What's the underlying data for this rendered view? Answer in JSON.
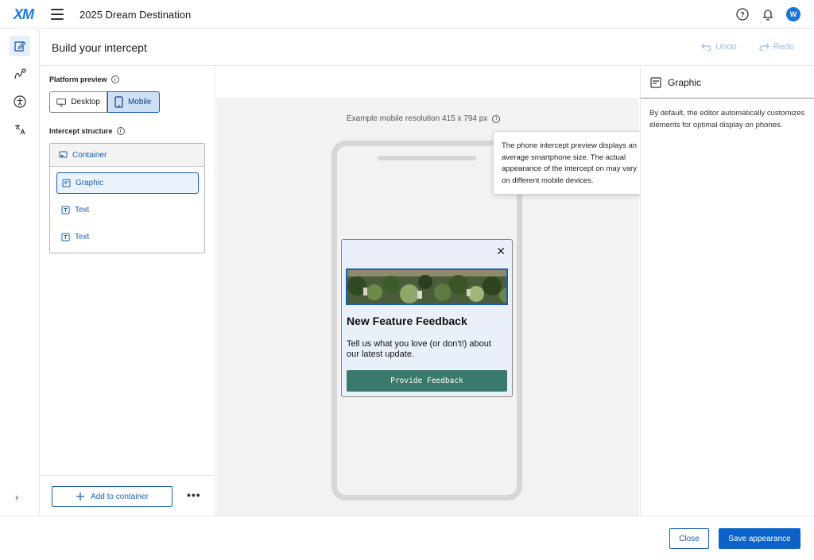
{
  "topbar": {
    "logo": "XM",
    "project_title": "2025 Dream Destination",
    "avatar_initial": "W"
  },
  "header": {
    "title": "Build your intercept",
    "undo_label": "Undo",
    "redo_label": "Redo"
  },
  "left_panel": {
    "platform_preview_label": "Platform preview",
    "desktop_label": "Desktop",
    "mobile_label": "Mobile",
    "selected_platform": "Mobile",
    "intercept_structure_label": "Intercept structure",
    "container_label": "Container",
    "items": [
      {
        "label": "Graphic",
        "icon": "graphic-icon",
        "selected": true
      },
      {
        "label": "Text",
        "icon": "text-icon",
        "selected": false
      },
      {
        "label": "Text",
        "icon": "text-icon",
        "selected": false
      }
    ],
    "add_button_label": "Add to container"
  },
  "canvas": {
    "resolution_text": "Example mobile resolution 415 x  794 px",
    "tooltip_text": "The phone intercept preview displays an average smartphone size. The actual appearance of the intercept on may vary on different mobile devices.",
    "intercept": {
      "heading": "New Feature Feedback",
      "body": "Tell us what you love (or don't!) about our latest update.",
      "cta_label": "Provide Feedback",
      "cta_color": "#3a7a6c",
      "background_color": "#e9f0fa"
    }
  },
  "right_panel": {
    "title": "Graphic",
    "description": "By default, the editor automatically customizes elements for optimal display on phones."
  },
  "footer": {
    "close_label": "Close",
    "save_label": "Save appearance"
  },
  "colors": {
    "accent": "#1a5fb4",
    "primary_button": "#0b63c9"
  }
}
